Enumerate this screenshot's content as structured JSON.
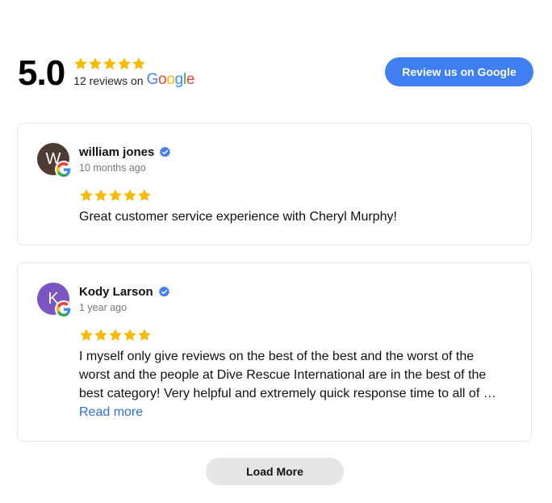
{
  "summary": {
    "rating": "5.0",
    "stars": 5,
    "count_text": "12 reviews on",
    "google_label": "Google",
    "review_button": "Review us on Google"
  },
  "colors": {
    "star": "#F6BB06",
    "primary_button": "#3f7ff1",
    "link": "#2f6fd6",
    "verified": "#3f7ff1"
  },
  "reviews": [
    {
      "avatar_letter": "W",
      "avatar_color": "#4e3b31",
      "author": "william jones",
      "verified": true,
      "time": "10 months ago",
      "stars": 5,
      "text": "Great customer service experience with Cheryl Murphy!",
      "read_more": ""
    },
    {
      "avatar_letter": "K",
      "avatar_color": "#7b56c3",
      "author": "Kody Larson",
      "verified": true,
      "time": "1 year ago",
      "stars": 5,
      "text": "I myself only give reviews on the best of the best and the worst of the worst and the people at Dive Rescue International are in the best of the best category! Very helpful and extremely quick response time to all of …",
      "read_more": "Read more"
    }
  ],
  "load_more": "Load More"
}
